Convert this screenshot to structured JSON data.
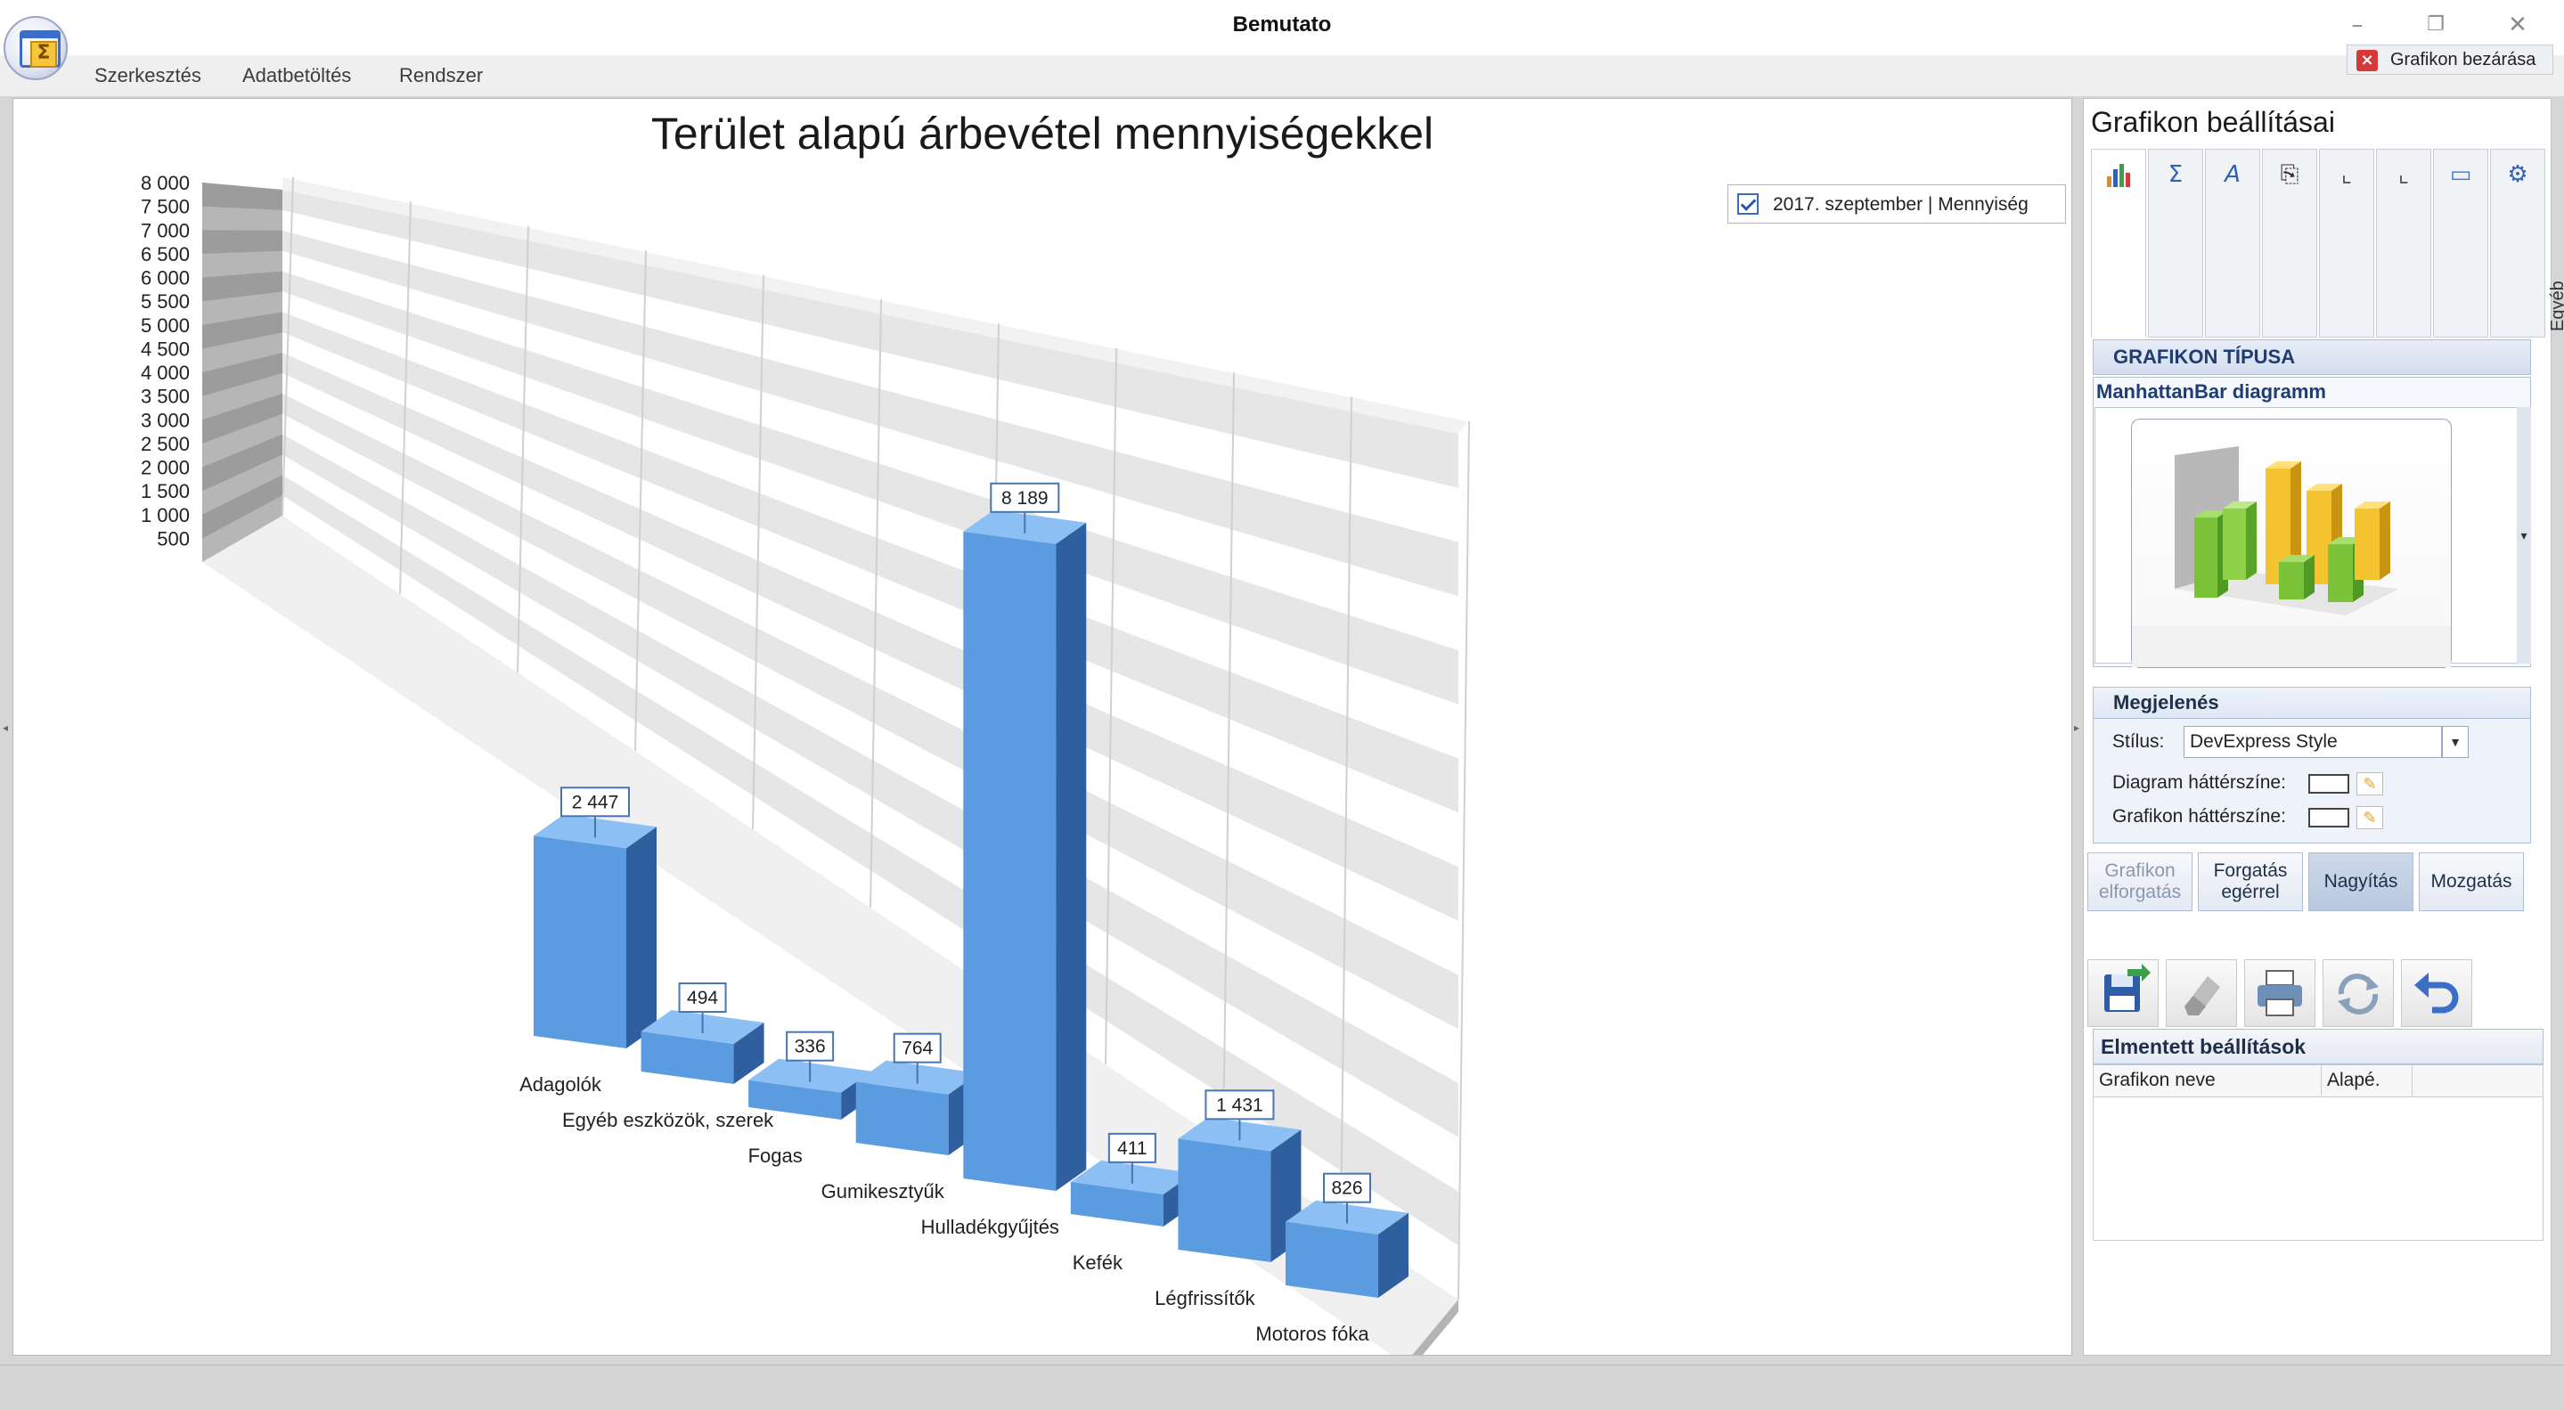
{
  "window": {
    "title": "Bemutato"
  },
  "menu": {
    "items": [
      "Szerkesztés",
      "Adatbetöltés",
      "Rendszer"
    ]
  },
  "toolbar": {
    "close_chart_label": "Grafikon bezárása"
  },
  "chart_data": {
    "type": "bar",
    "subtype": "3d-manhattan",
    "title": "Terület alapú árbevétel mennyiségekkel",
    "legend": {
      "entries": [
        "2017. szeptember | Mennyiség"
      ],
      "placement": "top-right"
    },
    "categories": [
      "Adagolók",
      "Egyéb eszközök, szerek",
      "Fogas",
      "Gumikesztyűk",
      "Hulladékgyűjtés",
      "Kefék",
      "Légfrissítők",
      "Motoros fóka"
    ],
    "series": [
      {
        "name": "2017. szeptember | Mennyiség",
        "values": [
          2447,
          494,
          336,
          764,
          8189,
          411,
          1431,
          826
        ],
        "color": "#5b9be0"
      }
    ],
    "value_labels": [
      "2 447",
      "494",
      "336",
      "764",
      "8 189",
      "411",
      "1 431",
      "826"
    ],
    "y_ticks": [
      "500",
      "1 000",
      "1 500",
      "2 000",
      "2 500",
      "3 000",
      "3 500",
      "4 000",
      "4 500",
      "5 000",
      "5 500",
      "6 000",
      "6 500",
      "7 000",
      "7 500",
      "8 000"
    ],
    "ylim": [
      0,
      8000
    ],
    "grid": true
  },
  "panel": {
    "title": "Grafikon beállításai",
    "tabs": [
      {
        "label": "Diagram",
        "icon": "bar-chart-icon"
      },
      {
        "label": "Értékek",
        "icon": "sigma-icon"
      },
      {
        "label": "Jelmagyarázat",
        "icon": "legend-pen-icon"
      },
      {
        "label": "Cím, címkék",
        "icon": "label-icon"
      },
      {
        "label": "X tengely",
        "icon": "x-axis-icon"
      },
      {
        "label": "Y tengely",
        "icon": "y-axis-icon"
      },
      {
        "label": "Szövegdoboz",
        "icon": "speech-bubble-icon"
      },
      {
        "label": "Egyéb",
        "icon": "other-settings-icon"
      }
    ],
    "chart_type_header": "GRAFIKON TÍPUSA",
    "chart_type_name": "ManhattanBar diagramm",
    "appearance_header": "Megjelenés",
    "style_label": "Stílus:",
    "style_value": "DevExpress Style",
    "diagram_bg_label": "Diagram háttérszíne:",
    "chart_bg_label": "Grafikon háttérszíne:",
    "mode_buttons": [
      "Grafikon elforgatás",
      "Forgatás egérrel",
      "Nagyítás",
      "Mozgatás"
    ],
    "saved_header": "Elmentett beállítások",
    "saved_columns": [
      "Grafikon neve",
      "Alapé."
    ]
  }
}
